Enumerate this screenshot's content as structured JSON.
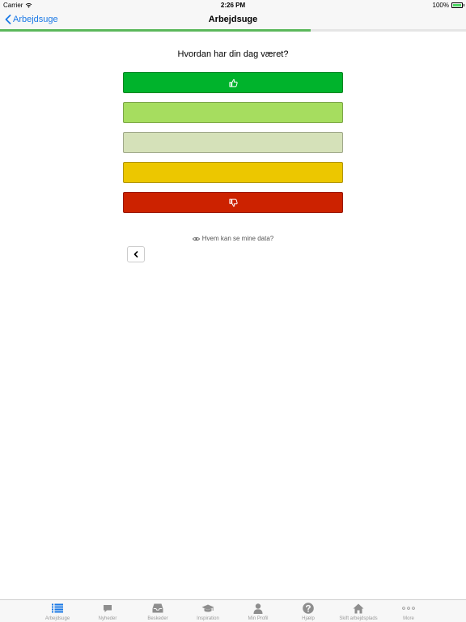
{
  "status": {
    "carrier": "Carrier",
    "time": "2:26 PM",
    "battery": "100%"
  },
  "nav": {
    "back_label": "Arbejdsuge",
    "title": "Arbejdsuge"
  },
  "progress": {
    "fraction": 0.667
  },
  "question": "Hvordan har din dag været?",
  "ratings": [
    {
      "color": "#00b32c",
      "icon": "thumbs-up-icon"
    },
    {
      "color": "#a6dd5f",
      "icon": ""
    },
    {
      "color": "#d5e1b9",
      "icon": ""
    },
    {
      "color": "#ecc700",
      "icon": ""
    },
    {
      "color": "#cc2200",
      "icon": "thumbs-down-icon"
    }
  ],
  "privacy_link": "Hvem kan se mine data?",
  "tabs": [
    {
      "label": "Arbejdsuge",
      "icon": "list-icon",
      "active": true
    },
    {
      "label": "Nyheder",
      "icon": "chat-icon",
      "active": false
    },
    {
      "label": "Beskeder",
      "icon": "inbox-icon",
      "active": false
    },
    {
      "label": "Inspiration",
      "icon": "graduation-cap-icon",
      "active": false
    },
    {
      "label": "Min Profil",
      "icon": "user-icon",
      "active": false
    },
    {
      "label": "Hjælp",
      "icon": "help-icon",
      "active": false
    },
    {
      "label": "Skift arbejdsplads",
      "icon": "home-icon",
      "active": false
    },
    {
      "label": "More",
      "icon": "more-icon",
      "active": false
    }
  ],
  "colors": {
    "accent": "#1a78e6",
    "progress": "#5cb85c",
    "tab_inactive": "#9b9b9b"
  }
}
